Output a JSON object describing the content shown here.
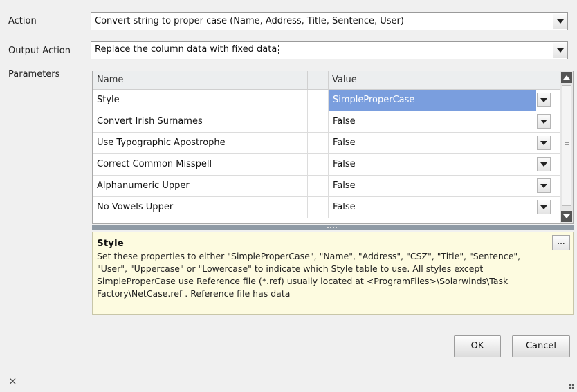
{
  "form": {
    "action_label": "Action",
    "action_value": "Convert string to proper case (Name, Address, Title, Sentence, User)",
    "output_action_label": "Output Action",
    "output_action_value": "Replace the column data with fixed data",
    "parameters_label": "Parameters"
  },
  "grid": {
    "columns": {
      "name": "Name",
      "value": "Value"
    },
    "rows": [
      {
        "name": "Style",
        "value": "SimpleProperCase"
      },
      {
        "name": "Convert Irish Surnames",
        "value": "False"
      },
      {
        "name": "Use Typographic Apostrophe",
        "value": "False"
      },
      {
        "name": "Correct Common Misspell",
        "value": "False"
      },
      {
        "name": "Alphanumeric Upper",
        "value": "False"
      },
      {
        "name": "No Vowels Upper",
        "value": "False"
      }
    ]
  },
  "description": {
    "title": "Style",
    "text": "Set these properties to either \"SimpleProperCase\", \"Name\", \"Address\", \"CSZ\", \"Title\", \"Sentence\", \"User\", \"Uppercase\" or \"Lowercase\" to indicate which Style table to use. All styles except SimpleProperCase use Reference file (*.ref) usually located at <ProgramFiles>\\Solarwinds\\Task Factory\\NetCase.ref . Reference file has data",
    "ellipsis_label": "..."
  },
  "buttons": {
    "ok": "OK",
    "cancel": "Cancel"
  },
  "footer": {
    "close": "×"
  },
  "colors": {
    "selected": "#7a9ede",
    "desc_bg": "#fdfbe0"
  }
}
